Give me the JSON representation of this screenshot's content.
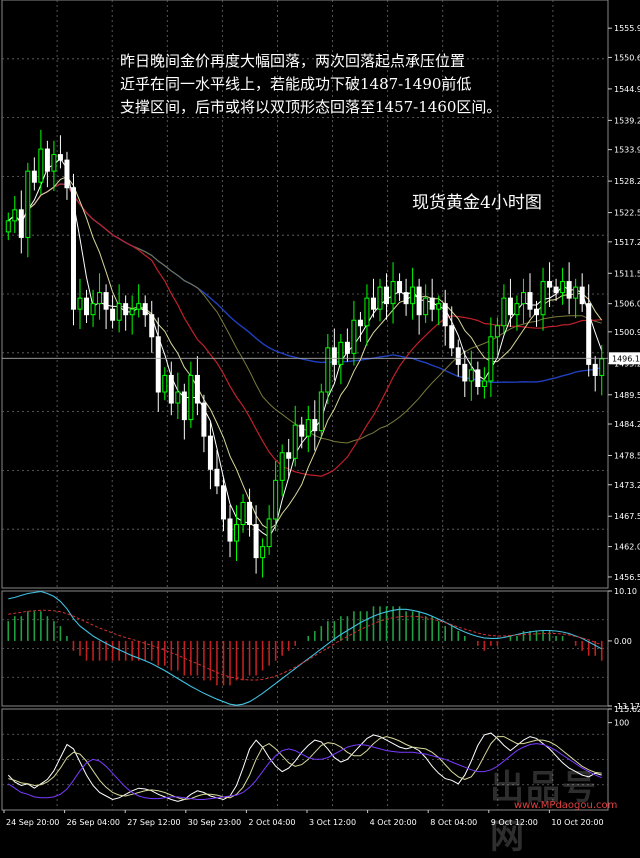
{
  "annotation": {
    "lines": [
      "昨日晚间金价再度大幅回落，两次回落起点承压位置",
      "近乎在同一水平线上，若能成功下破1487-1490前低",
      "支撑区间，后市或将以双顶形态回落至1457-1460区间。"
    ],
    "title": "现货黄金4小时图"
  },
  "watermark": {
    "logo_text": "出品号网",
    "url": "www.MPdaogou.com"
  },
  "chart_data": [
    {
      "type": "candlestick",
      "panel": "price",
      "ylim": [
        1454.5,
        1561
      ],
      "ticks": [
        1555.9,
        1550.6,
        1544.9,
        1539.2,
        1533.9,
        1528.2,
        1522.5,
        1517.2,
        1511.5,
        1506.0,
        1500.9,
        1495.2,
        1489.5,
        1484.2,
        1478.5,
        1473.2,
        1467.5,
        1462.0,
        1456.5
      ],
      "current_price_label": "1496.1",
      "current_price": 1496.1,
      "colors": {
        "up": "#00ff00",
        "down": "#ffffff",
        "ma_red": "#c0202a",
        "ma_blue": "#2040c0",
        "ma_khaki": "#d8d89a",
        "ma_white": "#ffffff",
        "ma_olive": "#7a7a3a"
      },
      "close": [
        1521,
        1523,
        1518,
        1530,
        1528,
        1534,
        1530,
        1533,
        1532,
        1527,
        1505,
        1507,
        1504,
        1506,
        1508,
        1505,
        1503,
        1506,
        1504,
        1505,
        1506,
        1504,
        1500,
        1490,
        1493,
        1488,
        1490,
        1485,
        1493,
        1488,
        1482,
        1476,
        1473,
        1467,
        1463,
        1466,
        1470,
        1466,
        1460,
        1462,
        1467,
        1474,
        1479,
        1478,
        1484,
        1482,
        1485,
        1483,
        1490,
        1498,
        1495,
        1499,
        1497,
        1503,
        1502,
        1507,
        1505,
        1509,
        1506,
        1510,
        1508,
        1506,
        1509,
        1504,
        1507,
        1505,
        1506,
        1502,
        1498,
        1495,
        1492,
        1494,
        1491,
        1492,
        1500,
        1502,
        1507,
        1504,
        1506,
        1508,
        1505,
        1504,
        1510,
        1509,
        1508,
        1510,
        1507,
        1509,
        1506,
        1495,
        1493,
        1496
      ]
    },
    {
      "type": "macd",
      "panel": "oscillator",
      "ylim": [
        -13.17,
        10.1
      ],
      "ticks": [
        10.1,
        0.0,
        -13.17
      ],
      "histogram": [
        4,
        5,
        5,
        6,
        6,
        6,
        5,
        4,
        3,
        1,
        -2,
        -3,
        -4,
        -4,
        -4,
        -4,
        -4,
        -4,
        -4,
        -4,
        -4,
        -4,
        -4,
        -5,
        -5,
        -6,
        -6,
        -7,
        -7,
        -7,
        -8,
        -8,
        -9,
        -9,
        -9,
        -8,
        -8,
        -7,
        -7,
        -6,
        -5,
        -4,
        -3,
        -2,
        -1,
        0,
        1,
        2,
        3,
        4,
        4,
        5,
        5,
        6,
        6,
        6,
        7,
        7,
        7,
        7,
        7,
        6,
        6,
        6,
        5,
        5,
        4,
        3,
        3,
        2,
        1,
        0,
        -1,
        -2,
        -1,
        -1,
        0,
        1,
        1,
        2,
        2,
        2,
        2,
        2,
        1,
        1,
        0,
        -1,
        -2,
        -3,
        -3,
        -4
      ],
      "signal": [
        5.4,
        5.6,
        5.8,
        6,
        6.1,
        6.2,
        6.2,
        6.1,
        5.9,
        5.5,
        5,
        4.4,
        3.8,
        3.2,
        2.6,
        2.1,
        1.6,
        1.1,
        0.7,
        0.3,
        -0.1,
        -0.5,
        -0.9,
        -1.4,
        -1.9,
        -2.4,
        -2.9,
        -3.5,
        -4.1,
        -4.6,
        -5.2,
        -5.8,
        -6.4,
        -6.9,
        -7.3,
        -7.6,
        -7.8,
        -7.9,
        -7.9,
        -7.8,
        -7.5,
        -7.1,
        -6.6,
        -6,
        -5.3,
        -4.6,
        -3.8,
        -3,
        -2.2,
        -1.4,
        -0.6,
        0.2,
        0.9,
        1.6,
        2.3,
        2.9,
        3.5,
        4,
        4.4,
        4.7,
        4.9,
        5,
        5,
        4.9,
        4.7,
        4.4,
        4.1,
        3.7,
        3.3,
        2.8,
        2.4,
        2,
        1.6,
        1.3,
        1.1,
        1,
        1,
        1.1,
        1.2,
        1.3,
        1.4,
        1.4,
        1.5,
        1.5,
        1.5,
        1.4,
        1.2,
        0.9,
        0.6,
        0.2,
        -0.3,
        -0.8
      ],
      "main": [
        8.5,
        8.8,
        9.2,
        9.6,
        9.8,
        10,
        9.6,
        9,
        8,
        6.5,
        4.5,
        3,
        2,
        1,
        0.2,
        -0.5,
        -1.2,
        -1.8,
        -2.4,
        -3,
        -3.5,
        -4,
        -4.6,
        -5.3,
        -6,
        -6.8,
        -7.6,
        -8.4,
        -9.2,
        -9.9,
        -10.6,
        -11.2,
        -11.8,
        -12.3,
        -12.8,
        -13,
        -12.8,
        -12.3,
        -11.5,
        -10.6,
        -9.6,
        -8.6,
        -7.6,
        -6.6,
        -5.6,
        -4.6,
        -3.6,
        -2.6,
        -1.6,
        -0.6,
        0.4,
        1.3,
        2.1,
        2.9,
        3.7,
        4.4,
        5,
        5.5,
        5.9,
        6.2,
        6.4,
        6.4,
        6.2,
        5.9,
        5.5,
        5,
        4.4,
        3.8,
        3.1,
        2.4,
        1.8,
        1.3,
        0.9,
        0.6,
        0.5,
        0.5,
        0.7,
        1,
        1.3,
        1.6,
        1.8,
        2,
        2.1,
        2.1,
        2,
        1.8,
        1.5,
        1,
        0.5,
        -0.2,
        -0.9,
        -1.6
      ]
    },
    {
      "type": "line",
      "panel": "stochastic",
      "ylim": [
        0,
        115.62
      ],
      "ticks": [
        115.62,
        100
      ],
      "series": [
        {
          "color": "#ffffff",
          "values": [
            40,
            32,
            28,
            30,
            25,
            30,
            35,
            45,
            60,
            75,
            70,
            55,
            40,
            28,
            20,
            16,
            12,
            14,
            18,
            22,
            25,
            24,
            22,
            18,
            15,
            12,
            10,
            12,
            18,
            22,
            20,
            16,
            14,
            12,
            16,
            28,
            48,
            70,
            80,
            72,
            60,
            50,
            44,
            48,
            56,
            66,
            74,
            80,
            78,
            70,
            60,
            55,
            58,
            66,
            74,
            82,
            86,
            84,
            80,
            76,
            72,
            70,
            72,
            68,
            60,
            50,
            42,
            36,
            34,
            30,
            40,
            56,
            74,
            86,
            88,
            82,
            74,
            68,
            74,
            80,
            84,
            82,
            76,
            70,
            62,
            54,
            48,
            44,
            40,
            38,
            42,
            40
          ]
        },
        {
          "color": "#d8d89a",
          "values": [
            36,
            34,
            31,
            30,
            28,
            29,
            32,
            38,
            48,
            60,
            66,
            64,
            56,
            45,
            34,
            26,
            20,
            17,
            16,
            18,
            20,
            22,
            23,
            22,
            20,
            17,
            14,
            12,
            13,
            16,
            18,
            18,
            17,
            15,
            14,
            18,
            26,
            40,
            58,
            72,
            76,
            70,
            62,
            54,
            50,
            52,
            58,
            66,
            74,
            77,
            76,
            72,
            66,
            62,
            62,
            68,
            76,
            82,
            84,
            82,
            79,
            75,
            72,
            71,
            70,
            66,
            60,
            52,
            44,
            38,
            35,
            38,
            48,
            62,
            76,
            84,
            84,
            80,
            76,
            76,
            78,
            80,
            80,
            78,
            74,
            68,
            62,
            56,
            50,
            46,
            43,
            42
          ]
        },
        {
          "color": "#7a3aff",
          "values": [
            30,
            25,
            20,
            18,
            15,
            14,
            14,
            15,
            18,
            24,
            34,
            45,
            54,
            58,
            56,
            50,
            42,
            34,
            26,
            20,
            16,
            14,
            13,
            13,
            14,
            15,
            15,
            14,
            13,
            12,
            12,
            13,
            14,
            15,
            16,
            17,
            20,
            26,
            34,
            44,
            54,
            62,
            68,
            70,
            68,
            64,
            60,
            58,
            58,
            60,
            64,
            68,
            72,
            74,
            75,
            74,
            72,
            70,
            68,
            67,
            66,
            66,
            66,
            65,
            64,
            62,
            60,
            58,
            55,
            52,
            49,
            46,
            44,
            44,
            46,
            50,
            56,
            62,
            68,
            72,
            75,
            76,
            75,
            72,
            68,
            63,
            58,
            53,
            48,
            44,
            40,
            37
          ]
        }
      ]
    }
  ],
  "time_axis": [
    "24 Sep 20:00",
    "26 Sep 04:00",
    "27 Sep 12:00",
    "30 Sep 23:00",
    "2 Oct 04:00",
    "3 Oct 12:00",
    "4 Oct 20:00",
    "8 Oct 04:00",
    "9 Oct 12:00",
    "10 Oct 20:00"
  ]
}
